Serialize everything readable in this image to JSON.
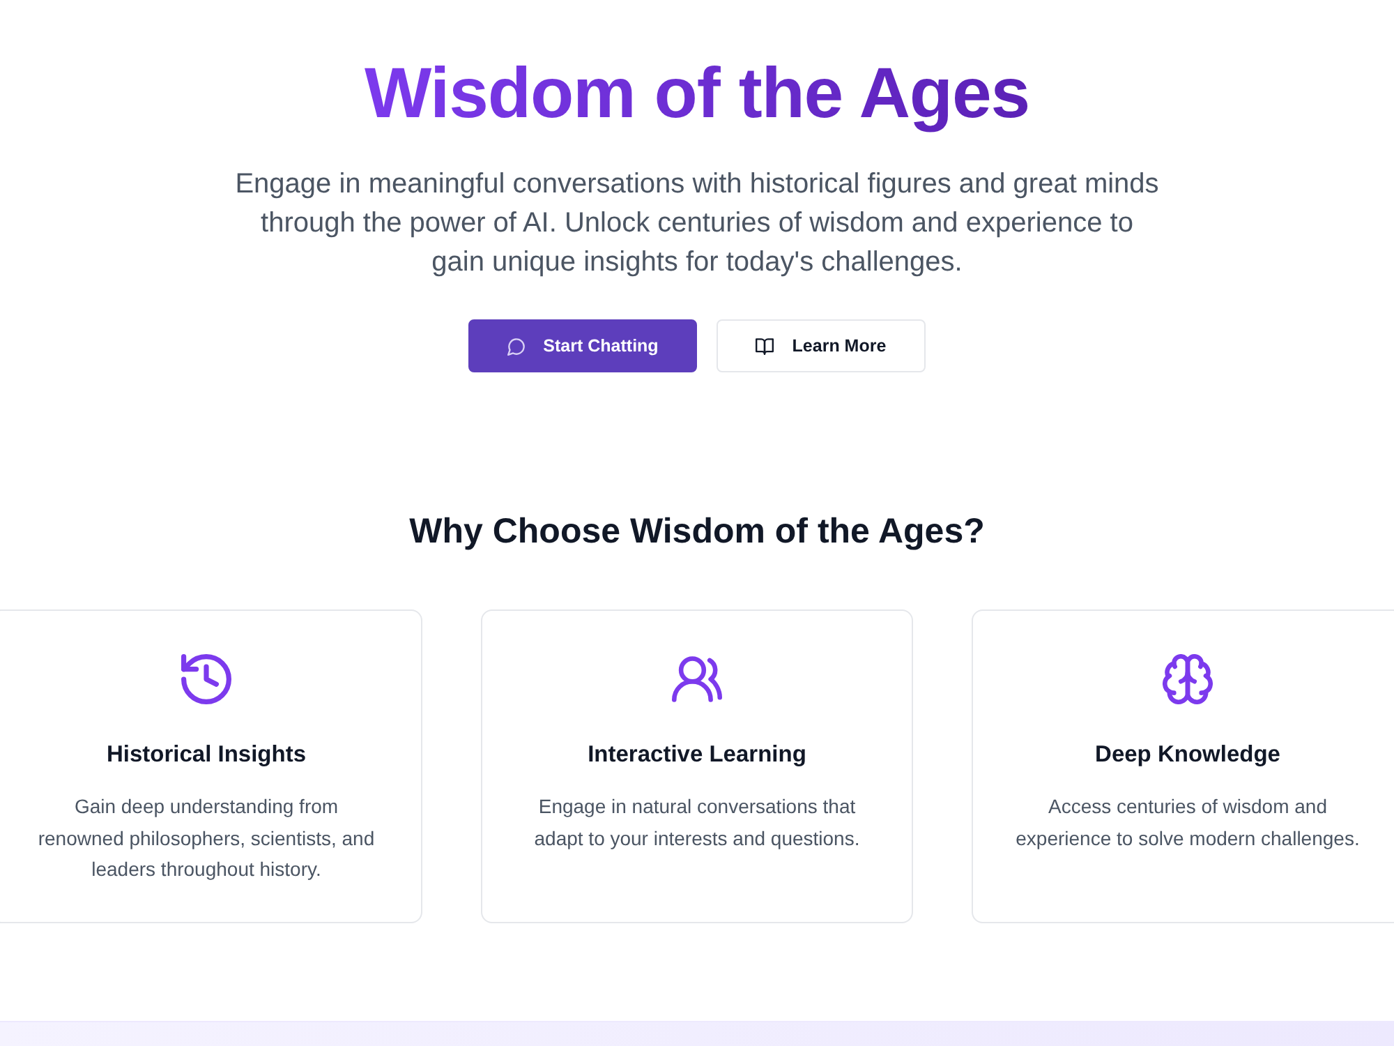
{
  "hero": {
    "title": "Wisdom of the Ages",
    "subtitle": "Engage in meaningful conversations with historical figures and great minds through the power of AI. Unlock centuries of wisdom and experience to gain unique insights for today's challenges.",
    "buttons": [
      {
        "label": "Start Chatting",
        "kind": "primary"
      },
      {
        "label": "Learn More",
        "kind": "secondary"
      }
    ]
  },
  "features": {
    "heading": "Why Choose Wisdom of the Ages?",
    "cards": [
      {
        "title": "Historical Insights",
        "description": "Gain deep understanding from renowned philosophers, scientists, and leaders throughout history."
      },
      {
        "title": "Interactive Learning",
        "description": "Engage in natural conversations that adapt to your interests and questions."
      },
      {
        "title": "Deep Knowledge",
        "description": "Access centuries of wisdom and experience to solve modern challenges."
      }
    ]
  }
}
